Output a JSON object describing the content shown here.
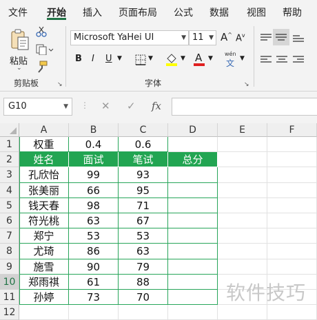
{
  "ribbon": {
    "tabs": [
      "文件",
      "开始",
      "插入",
      "页面布局",
      "公式",
      "数据",
      "视图",
      "帮助"
    ],
    "active_tab": "开始",
    "clipboard": {
      "paste_label": "粘贴",
      "group_label": "剪贴板"
    },
    "font": {
      "name": "Microsoft YaHei UI",
      "size": "11",
      "bold": "B",
      "italic": "I",
      "underline": "U",
      "grow": "A",
      "shrink": "A",
      "phonetic_top": "wén",
      "phonetic_bottom": "文",
      "group_label": "字体"
    }
  },
  "formula_bar": {
    "name_box": "G10",
    "fx_label": "fx",
    "value": ""
  },
  "grid": {
    "columns": [
      "A",
      "B",
      "C",
      "D",
      "E",
      "F"
    ],
    "rows": [
      "1",
      "2",
      "3",
      "4",
      "5",
      "6",
      "7",
      "8",
      "9",
      "10",
      "11",
      "12"
    ],
    "selected_row": "10",
    "weights": {
      "label": "权重",
      "interview": "0.4",
      "written": "0.6"
    },
    "headers": {
      "name": "姓名",
      "interview": "面试",
      "written": "笔试",
      "total": "总分"
    },
    "records": [
      {
        "name": "孔欣怡",
        "interview": "99",
        "written": "93"
      },
      {
        "name": "张美丽",
        "interview": "66",
        "written": "95"
      },
      {
        "name": "钱天春",
        "interview": "98",
        "written": "71"
      },
      {
        "name": "符光桃",
        "interview": "63",
        "written": "67"
      },
      {
        "name": "郑宁",
        "interview": "53",
        "written": "53"
      },
      {
        "name": "尤琦",
        "interview": "86",
        "written": "63"
      },
      {
        "name": "施雪",
        "interview": "90",
        "written": "79"
      },
      {
        "name": "郑雨祺",
        "interview": "61",
        "written": "88"
      },
      {
        "name": "孙婷",
        "interview": "73",
        "written": "70"
      }
    ]
  },
  "watermark": "软件技巧",
  "colors": {
    "header_fill": "#22a552",
    "accent": "#217346",
    "table_border": "#27a559"
  }
}
